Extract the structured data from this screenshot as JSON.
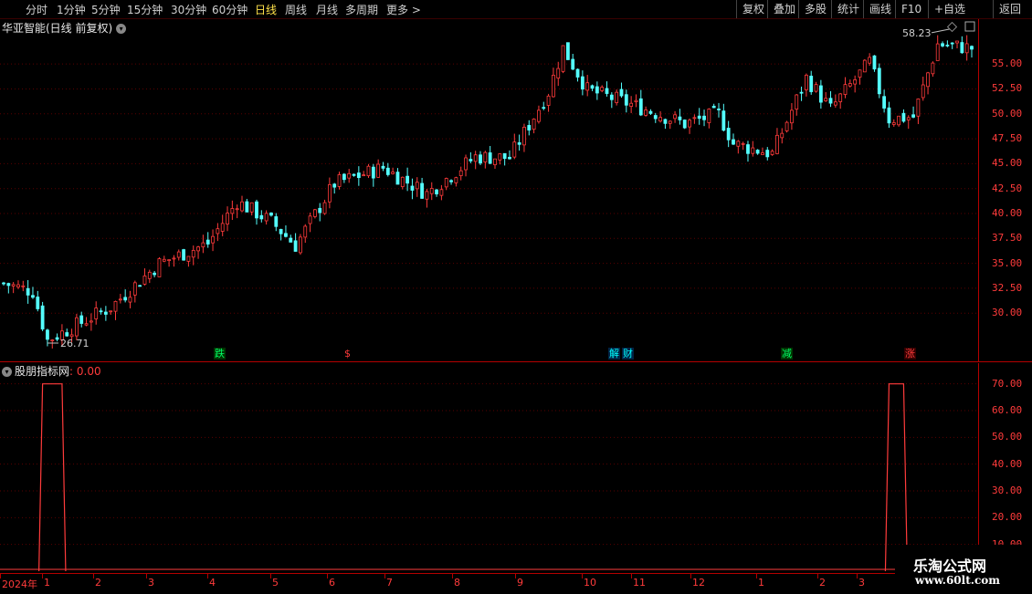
{
  "toolbar": {
    "left_items": [
      "分时",
      "1分钟",
      "5分钟",
      "15分钟",
      "30分钟",
      "60分钟",
      "日线",
      "周线",
      "月线",
      "多周期",
      "更多 >"
    ],
    "active_item": "日线",
    "right_items": [
      "复权",
      "叠加",
      "多股",
      "统计",
      "画线",
      "F10",
      "+自选",
      "返回"
    ]
  },
  "stock": {
    "title": "华亚智能(日线 前复权)",
    "high_label": "58.23",
    "low_label": "26.71"
  },
  "price_axis": {
    "labels": [
      "55.00",
      "52.50",
      "50.00",
      "47.50",
      "45.00",
      "42.50",
      "40.00",
      "37.50",
      "35.00",
      "32.50",
      "30.00"
    ],
    "values": [
      55.0,
      52.5,
      50.0,
      47.5,
      45.0,
      42.5,
      40.0,
      37.5,
      35.0,
      32.5,
      30.0
    ]
  },
  "events": [
    {
      "text": "跌",
      "color": "#00ff66",
      "bg": "#003300"
    },
    {
      "text": "$",
      "color": "#ff3b3b",
      "bg": "#000000"
    },
    {
      "text": "解",
      "color": "#00ffff",
      "bg": "#002244"
    },
    {
      "text": "财",
      "color": "#00ffff",
      "bg": "#002244"
    },
    {
      "text": "减",
      "color": "#00ff66",
      "bg": "#003300"
    },
    {
      "text": "涨",
      "color": "#ff3b3b",
      "bg": "#330000"
    }
  ],
  "indicator": {
    "name": "股朋指标网",
    "value_text": ": 0.00",
    "axis_labels": [
      "70.00",
      "60.00",
      "50.00",
      "40.00",
      "30.00",
      "20.00",
      "10.00"
    ],
    "axis_values": [
      70,
      60,
      50,
      40,
      30,
      20,
      10
    ],
    "pulses": [
      {
        "start_index": 8,
        "end_index": 12,
        "value": 70
      },
      {
        "start_index": 182,
        "end_index": 185,
        "value": 70
      }
    ]
  },
  "date_axis": {
    "labels": [
      "2024年",
      "1",
      "2",
      "3",
      "4",
      "5",
      "6",
      "7",
      "8",
      "9",
      "10",
      "11",
      "12",
      "1",
      "2",
      "3"
    ]
  },
  "watermark": {
    "line1": "乐淘公式网",
    "line2": "www.60lt.com"
  },
  "colors": {
    "up": "#ff3b3b",
    "down": "#54ffff",
    "grid": "#5a0000",
    "axis": "#b40000",
    "text_yellow": "#ffe24a"
  },
  "chart_data": {
    "type": "candlestick",
    "price_range": [
      27.0,
      59.5
    ],
    "indicator_range": [
      0,
      75
    ],
    "anchors": [
      [
        0,
        33.0
      ],
      [
        6,
        32.2
      ],
      [
        9,
        27.3
      ],
      [
        13,
        28.3
      ],
      [
        22,
        30.6
      ],
      [
        32,
        35.0
      ],
      [
        42,
        37.0
      ],
      [
        48,
        41.2
      ],
      [
        55,
        39.2
      ],
      [
        60,
        36.8
      ],
      [
        68,
        43.0
      ],
      [
        78,
        44.6
      ],
      [
        87,
        42.0
      ],
      [
        97,
        45.7
      ],
      [
        104,
        45.6
      ],
      [
        112,
        52.2
      ],
      [
        115,
        56.6
      ],
      [
        120,
        52.4
      ],
      [
        125,
        51.6
      ],
      [
        130,
        50.8
      ],
      [
        140,
        49.0
      ],
      [
        147,
        50.0
      ],
      [
        150,
        47.0
      ],
      [
        158,
        46.0
      ],
      [
        165,
        53.6
      ],
      [
        170,
        50.5
      ],
      [
        178,
        55.2
      ],
      [
        182,
        49.5
      ],
      [
        187,
        49.7
      ],
      [
        192,
        57.0
      ],
      [
        199,
        56.6
      ]
    ],
    "candle_count": 200
  }
}
